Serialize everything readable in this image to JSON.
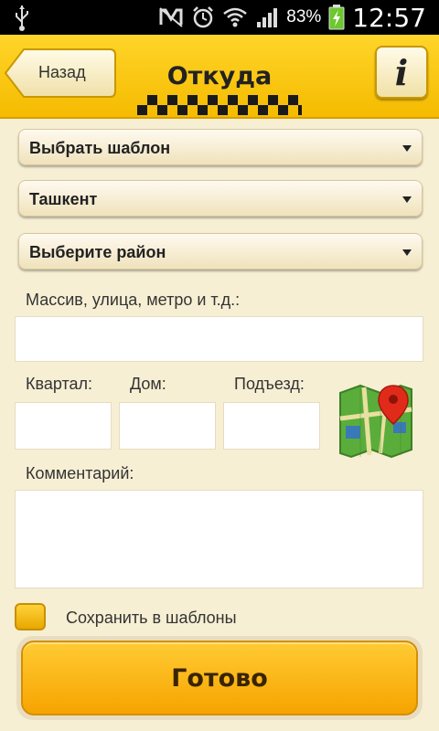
{
  "status_bar": {
    "battery_percent": "83%",
    "time": "12:57",
    "icons": [
      "usb-icon",
      "mute-icon",
      "alarm-icon",
      "wifi-icon",
      "signal-icon",
      "battery-charging-icon"
    ]
  },
  "header": {
    "back_label": "Назад",
    "title": "Откуда",
    "info_label": "i"
  },
  "form": {
    "template_select": "Выбрать шаблон",
    "city_select": "Ташкент",
    "district_select": "Выберите район",
    "street_label": "Массив, улица, метро и т.д.:",
    "street_value": "",
    "block_label": "Квартал:",
    "block_value": "",
    "house_label": "Дом:",
    "house_value": "",
    "entrance_label": "Подъезд:",
    "entrance_value": "",
    "map_icon": "map-pin-icon",
    "comment_label": "Комментарий:",
    "comment_value": "",
    "save_template_label": "Сохранить в шаблоны",
    "save_template_checked": false
  },
  "done_button": "Готово",
  "colors": {
    "header": "#fcc70a",
    "background": "#f7efd4",
    "accent": "#f6a400",
    "statusbar": "#000000"
  }
}
